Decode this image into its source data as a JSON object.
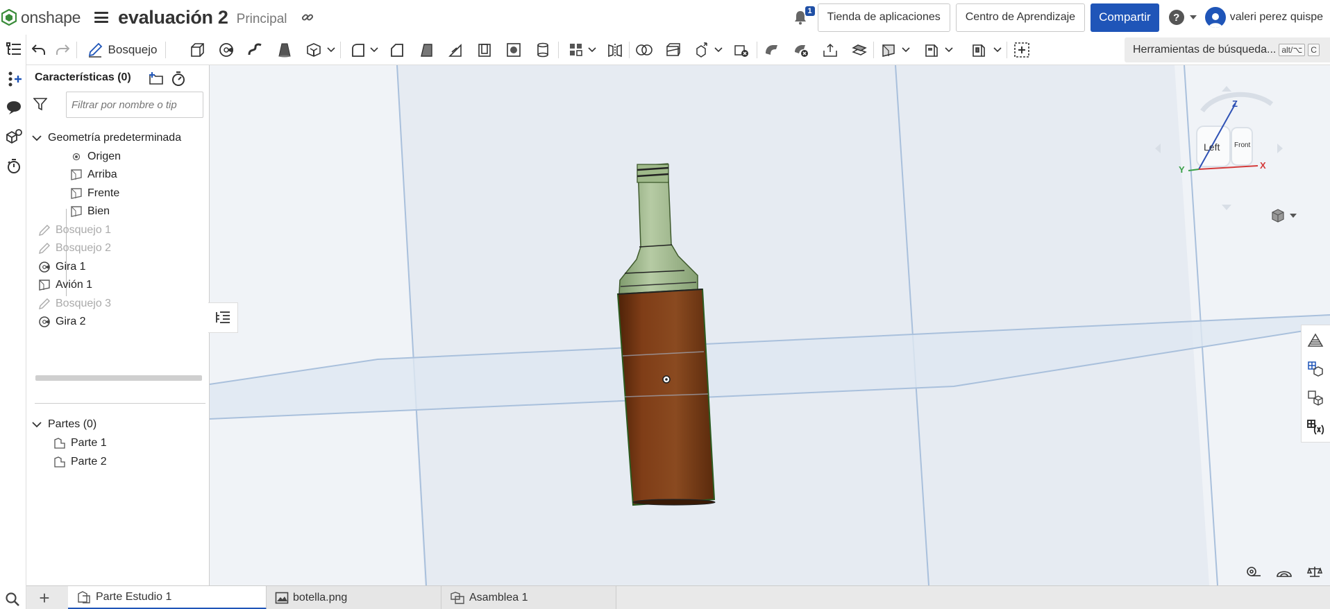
{
  "header": {
    "brand": "onshape",
    "doc_title": "evaluación 2",
    "workspace": "Principal",
    "notifications_count": "1",
    "app_store": "Tienda de aplicaciones",
    "learning_center": "Centro de Aprendizaje",
    "share": "Compartir",
    "user_name": "valeri perez quispe"
  },
  "toolbar": {
    "sketch_label": "Bosquejo",
    "search_placeholder": "Herramientas de búsqueda...",
    "shortcut_key1": "alt/⌥",
    "shortcut_key2": "C"
  },
  "feature_panel": {
    "header": "Características (0)",
    "filter_placeholder": "Filtrar por nombre o tip",
    "default_geometry": "Geometría predeterminada",
    "origin": "Origen",
    "planes": [
      "Arriba",
      "Frente",
      "Bien"
    ],
    "features": [
      {
        "label": "Bosquejo 1",
        "type": "sketch",
        "suppressed": true
      },
      {
        "label": "Bosquejo 2",
        "type": "sketch",
        "suppressed": true
      },
      {
        "label": "Gira 1",
        "type": "revolve",
        "suppressed": false
      },
      {
        "label": "Avión 1",
        "type": "plane",
        "suppressed": false
      },
      {
        "label": "Bosquejo 3",
        "type": "sketch",
        "suppressed": true
      },
      {
        "label": "Gira 2",
        "type": "revolve",
        "suppressed": false
      }
    ],
    "parts_header": "Partes (0)",
    "parts": [
      "Parte 1",
      "Parte 2"
    ]
  },
  "viewcube": {
    "left_face": "Left",
    "front_face": "Front",
    "axis_x": "X",
    "axis_y": "Y",
    "axis_z": "Z"
  },
  "tabs": [
    {
      "label": "Parte Estudio 1",
      "active": true
    },
    {
      "label": "botella.png",
      "active": false
    },
    {
      "label": "Asamblea 1",
      "active": false
    }
  ],
  "colors": {
    "primary": "#1f55b8",
    "bottle_body": "#7a3a16",
    "bottle_neck": "#9db88a",
    "plane_line": "#a9c0dc"
  }
}
